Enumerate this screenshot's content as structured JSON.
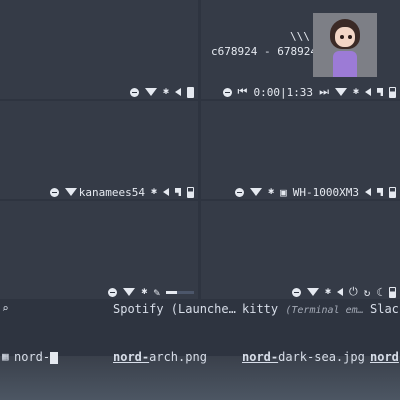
{
  "top_right": {
    "glyph": "\\\\\\",
    "id_text": "c678924 - 678924",
    "time": "0:00|1:33"
  },
  "middle_left": {
    "network": "kanamees54"
  },
  "middle_right": {
    "device": "WH-1000XM3"
  },
  "launcher": {
    "items": [
      {
        "app": "Spotify (Launche…",
        "sub": ""
      },
      {
        "app": "kitty",
        "sub": "(Terminal em…"
      },
      {
        "app": "Slac",
        "sub": ""
      }
    ]
  },
  "search": {
    "query": "nord-",
    "results": [
      {
        "match": "nord-",
        "rest": "arch.png"
      },
      {
        "match": "nord-",
        "rest": "dark-sea.jpg"
      },
      {
        "match": "nord",
        "rest": ""
      }
    ]
  },
  "icons": [
    "spotify-icon",
    "wifi-icon",
    "bluetooth-icon",
    "volume-icon",
    "battery-icon",
    "power-icon",
    "lock-icon",
    "night-icon",
    "search-icon",
    "image-icon"
  ]
}
